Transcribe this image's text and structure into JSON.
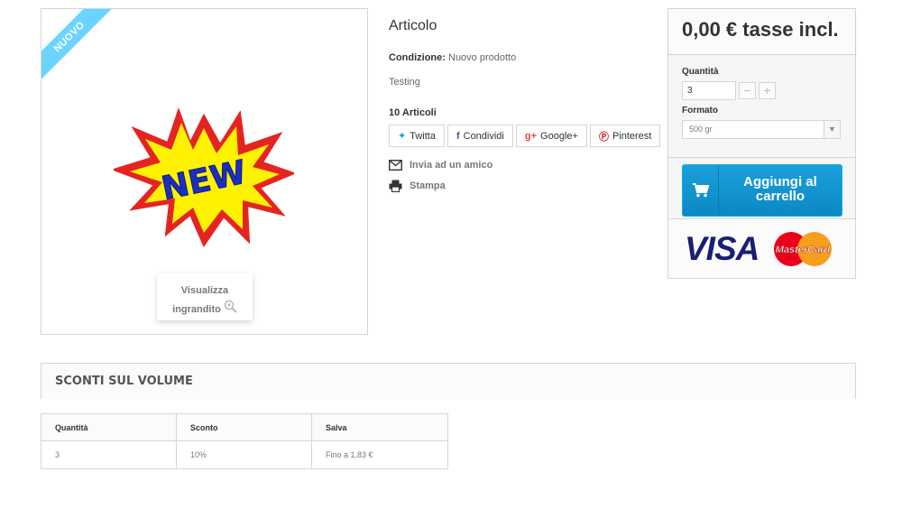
{
  "image": {
    "ribbon": "Nuovo",
    "burst_text": "NEW",
    "zoom_line1": "Visualizza",
    "zoom_line2": "ingrandito",
    "zoom_icon": "magnifier-plus-icon"
  },
  "product": {
    "title": "Articolo",
    "condition_label": "Condizione:",
    "condition_value": "Nuovo prodotto",
    "description": "Testing",
    "stock": "10 Articoli"
  },
  "share": [
    {
      "label": "Twitta",
      "icon": "twitter-icon",
      "color": "#00aced"
    },
    {
      "label": "Condividi",
      "icon": "facebook-icon",
      "color": "#3b5998"
    },
    {
      "label": "Google+",
      "icon": "google-plus-icon",
      "color": "#dd4b39"
    },
    {
      "label": "Pinterest",
      "icon": "pinterest-icon",
      "color": "#cb2027"
    }
  ],
  "links": {
    "send_friend": "Invia ad un amico",
    "print": "Stampa"
  },
  "buy": {
    "price": "0,00 € tasse incl.",
    "qty_label": "Quantità",
    "qty_value": "3",
    "format_label": "Formato",
    "format_value": "500 gr",
    "cart_label_1": "Aggiungi al",
    "cart_label_2": "carrello",
    "accent": "#1aa0dc",
    "cards": [
      "VISA",
      "MasterCard"
    ]
  },
  "volume": {
    "title": "SCONTI SUL VOLUME",
    "headers": [
      "Quantità",
      "Sconto",
      "Salva"
    ],
    "rows": [
      [
        "3",
        "10%",
        "Fino a 1,83 €"
      ]
    ]
  }
}
